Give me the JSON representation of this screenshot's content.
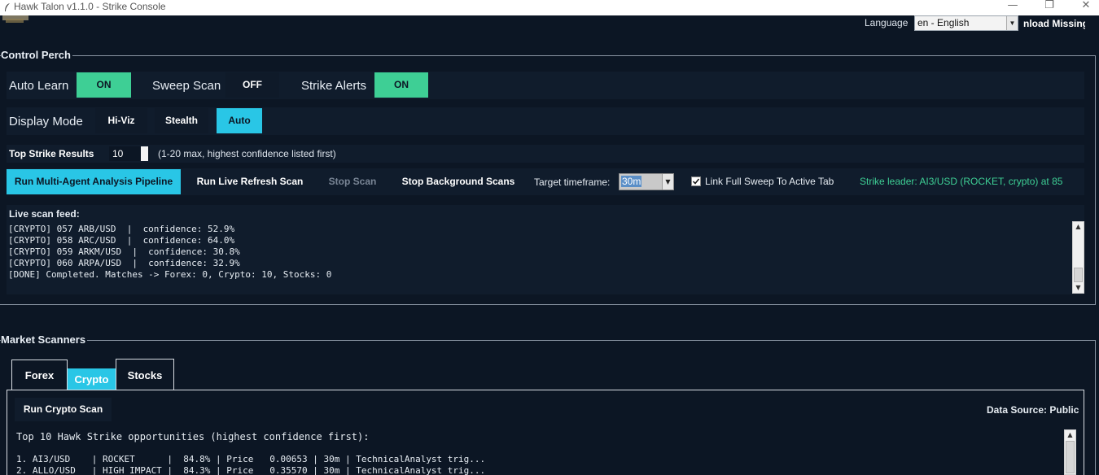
{
  "window": {
    "title": "Hawk Talon v1.1.0 - Strike Console",
    "min": "—",
    "max": "❐",
    "close": "✕"
  },
  "top": {
    "language_label": "Language",
    "language_value": "en - English",
    "download_label": "nload Missing"
  },
  "control": {
    "label": "Control Perch",
    "auto_learn": {
      "label": "Auto Learn",
      "state": "ON"
    },
    "sweep_scan": {
      "label": "Sweep Scan",
      "state": "OFF"
    },
    "strike_alerts": {
      "label": "Strike Alerts",
      "state": "ON"
    },
    "display_mode": {
      "label": "Display Mode",
      "options": [
        "Hi-Viz",
        "Stealth",
        "Auto"
      ],
      "selected": "Auto"
    },
    "top_results": {
      "label": "Top Strike Results",
      "value": "10",
      "hint": "(1-20 max, highest confidence listed first)"
    }
  },
  "actions": {
    "run_pipeline": "Run Multi-Agent Analysis Pipeline",
    "run_live": "Run Live Refresh Scan",
    "stop_scan": "Stop Scan",
    "stop_bg": "Stop Background Scans",
    "timeframe_label": "Target timeframe:",
    "timeframe_value": "30m",
    "link_sweep": "Link Full Sweep To Active Tab",
    "leader": "Strike leader: AI3/USD (ROCKET, crypto) at 85"
  },
  "feed": {
    "title": "Live scan feed:",
    "lines": [
      "[CRYPTO] 057 ARB/USD  |  confidence: 52.9%",
      "[CRYPTO] 058 ARC/USD  |  confidence: 64.0%",
      "[CRYPTO] 059 ARKM/USD  |  confidence: 30.8%",
      "[CRYPTO] 060 ARPA/USD  |  confidence: 32.9%",
      "[DONE] Completed. Matches -> Forex: 0, Crypto: 10, Stocks: 0"
    ]
  },
  "market": {
    "label": "Market Scanners",
    "tabs": [
      "Forex",
      "Crypto",
      "Stocks"
    ],
    "active_tab": "Crypto",
    "run_button": "Run Crypto Scan",
    "data_source": "Data Source: Public",
    "heading": "Top 10 Hawk Strike opportunities (highest confidence first):",
    "rows": [
      "1. AI3/USD    | ROCKET      |  84.8% | Price   0.00653 | 30m | TechnicalAnalyst trig...",
      "2. ALLO/USD   | HIGH IMPACT |  84.3% | Price   0.35570 | 30m | TechnicalAnalyst trig..."
    ]
  },
  "colors": {
    "accent_on": "#3ecf95",
    "accent_active": "#29c6e6",
    "leader": "#3ecf95",
    "bg": "#0c1624"
  }
}
